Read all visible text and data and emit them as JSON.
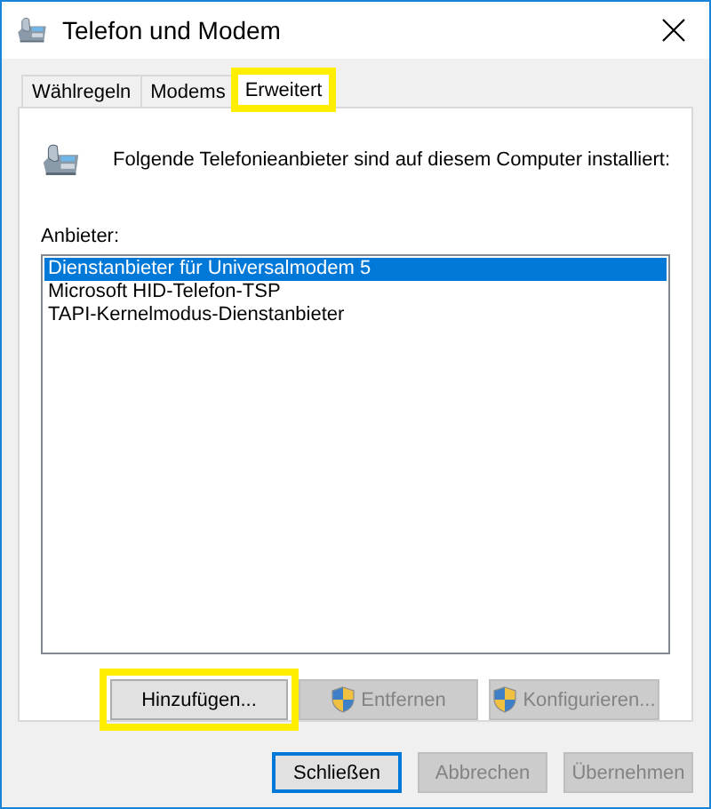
{
  "window": {
    "title": "Telefon und Modem"
  },
  "tabs": [
    {
      "label": "Wählregeln",
      "selected": false,
      "highlighted": false
    },
    {
      "label": "Modems",
      "selected": false,
      "highlighted": false
    },
    {
      "label": "Erweitert",
      "selected": true,
      "highlighted": true
    }
  ],
  "intro": "Folgende Telefonieanbieter sind auf diesem Computer installiert:",
  "list_label": "Anbieter:",
  "providers": [
    {
      "name": "Dienstanbieter für Universalmodem 5",
      "selected": true
    },
    {
      "name": "Microsoft HID-Telefon-TSP",
      "selected": false
    },
    {
      "name": "TAPI-Kernelmodus-Dienstanbieter",
      "selected": false
    }
  ],
  "panel_buttons": [
    {
      "label": "Hinzufügen...",
      "disabled": false,
      "shield": false,
      "highlighted": true
    },
    {
      "label": "Entfernen",
      "disabled": true,
      "shield": true,
      "highlighted": false
    },
    {
      "label": "Konfigurieren...",
      "disabled": true,
      "shield": true,
      "highlighted": false
    }
  ],
  "dialog_buttons": [
    {
      "label": "Schließen",
      "disabled": false,
      "default": true
    },
    {
      "label": "Abbrechen",
      "disabled": true,
      "default": false
    },
    {
      "label": "Übernehmen",
      "disabled": true,
      "default": false
    }
  ]
}
